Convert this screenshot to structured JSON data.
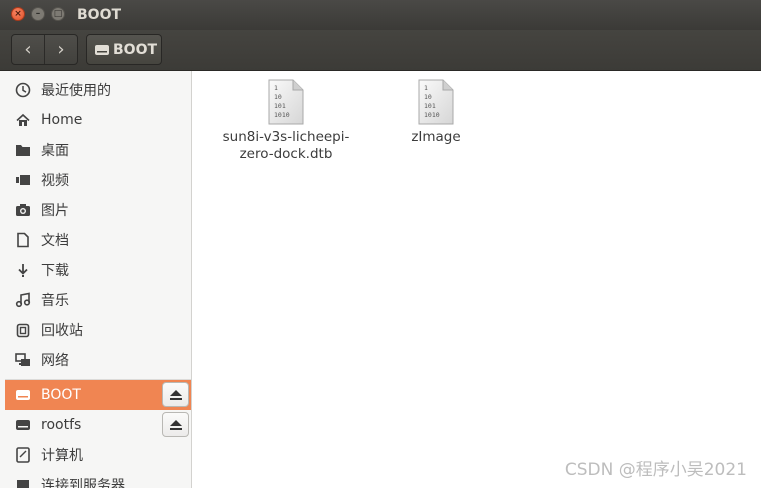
{
  "window": {
    "title": "BOOT",
    "close_glyph": "×",
    "minimize_glyph": "–",
    "maximize_glyph": "□"
  },
  "toolbar": {
    "back_glyph": "‹",
    "forward_glyph": "›",
    "path_label": "BOOT"
  },
  "sidebar": {
    "items": [
      {
        "label": "最近使用的",
        "icon": "clock-icon"
      },
      {
        "label": "Home",
        "icon": "home-icon"
      },
      {
        "label": "桌面",
        "icon": "folder-icon"
      },
      {
        "label": "视频",
        "icon": "video-icon"
      },
      {
        "label": "图片",
        "icon": "camera-icon"
      },
      {
        "label": "文档",
        "icon": "document-icon"
      },
      {
        "label": "下载",
        "icon": "download-icon"
      },
      {
        "label": "音乐",
        "icon": "music-icon"
      },
      {
        "label": "回收站",
        "icon": "trash-icon"
      },
      {
        "label": "网络",
        "icon": "network-icon"
      },
      {
        "label": "BOOT",
        "icon": "drive-icon",
        "active": true,
        "eject": true
      },
      {
        "label": "rootfs",
        "icon": "drive-icon",
        "eject": true
      },
      {
        "label": "计算机",
        "icon": "computer-icon"
      },
      {
        "label": "连接到服务器",
        "icon": "server-icon"
      }
    ]
  },
  "files": [
    {
      "name": "sun8i-v3s-licheepi-zero-dock.dtb",
      "icon": "binary-file-icon",
      "icon_text": [
        "1",
        "10",
        "101",
        "1010"
      ]
    },
    {
      "name": "zImage",
      "icon": "binary-file-icon",
      "icon_text": [
        "1",
        "10",
        "101",
        "1010"
      ]
    }
  ],
  "watermark": "CSDN @程序小吴2021",
  "colors": {
    "accent": "#f08552",
    "titlebar": "#3c3b37",
    "sidebar": "#f6f6f5"
  }
}
